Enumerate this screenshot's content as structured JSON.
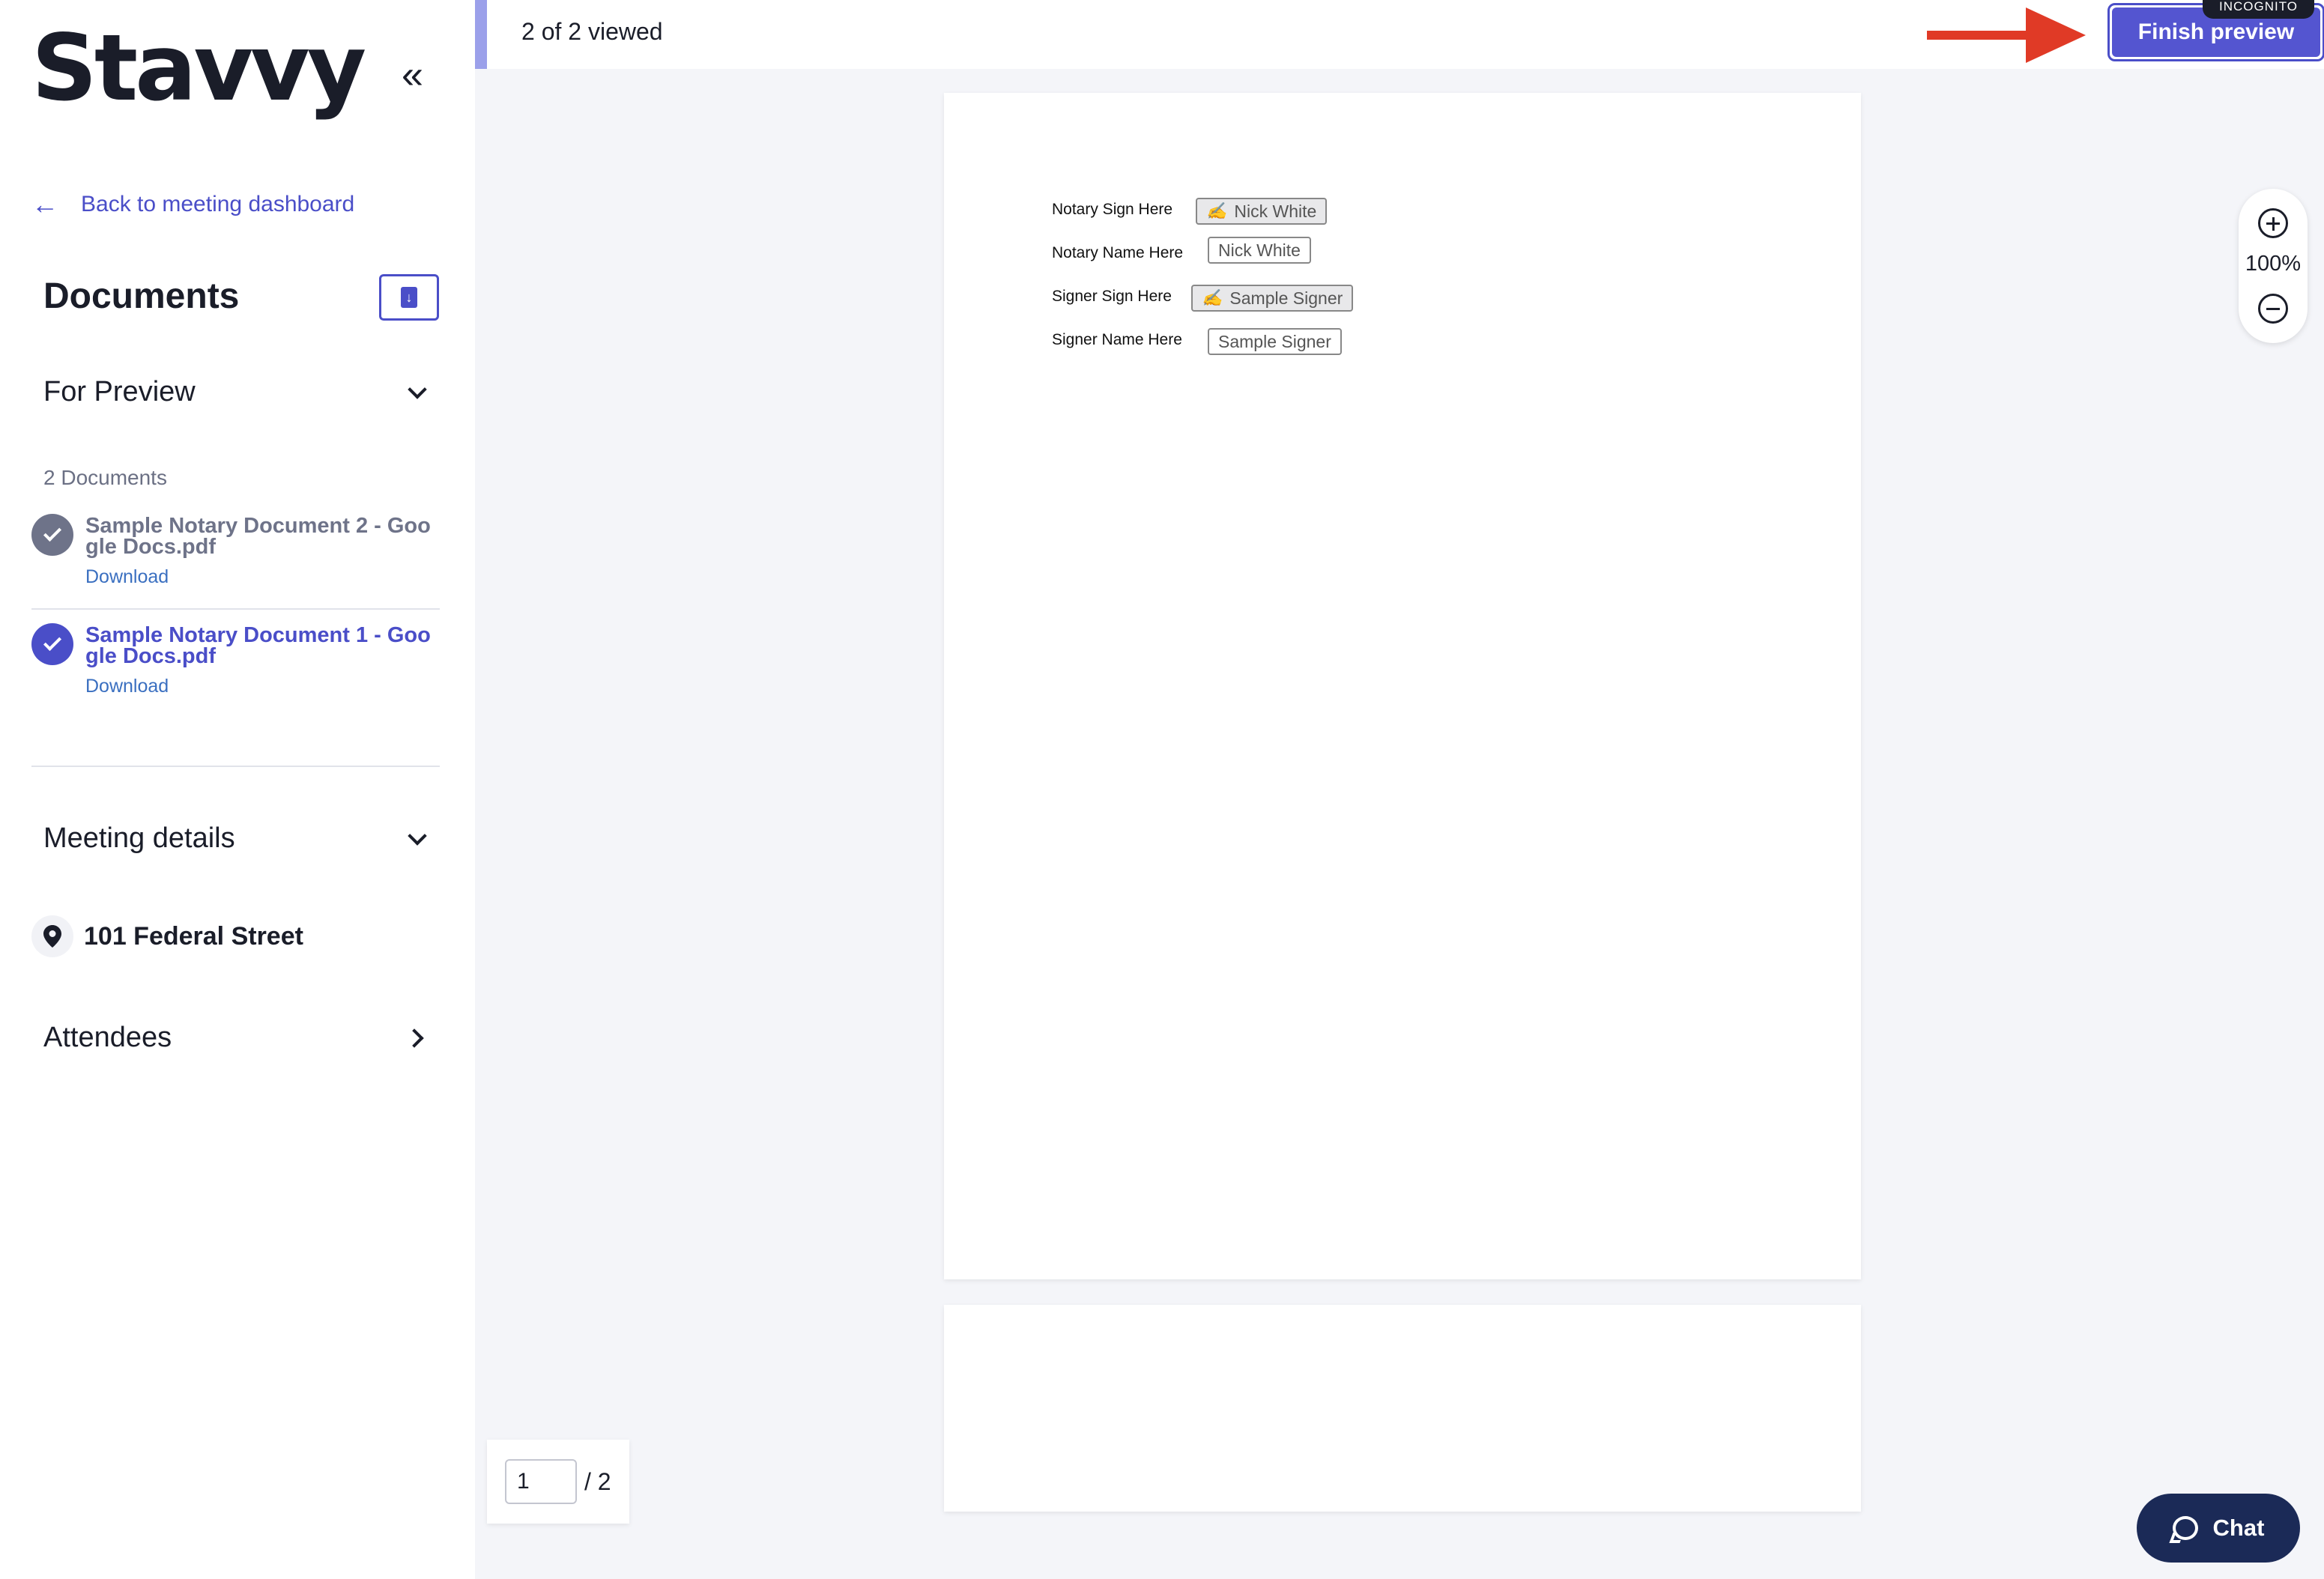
{
  "sidebar": {
    "logo": "Stavvy",
    "collapse_icon": "double-chevron-left-icon",
    "back_link": "Back to meeting dashboard",
    "documents_title": "Documents",
    "for_preview": {
      "label": "For Preview",
      "count_text": "2 Documents",
      "documents": [
        {
          "name": "Sample Notary Document 2 - Google Docs.pdf",
          "download": "Download",
          "viewed": true,
          "status_color": "#6e7389"
        },
        {
          "name": "Sample Notary Document 1 - Google Docs.pdf",
          "download": "Download",
          "viewed": true,
          "status_color": "#4a4ec8"
        }
      ]
    },
    "meeting_details": {
      "label": "Meeting details",
      "address": "101 Federal Street"
    },
    "attendees": {
      "label": "Attendees"
    }
  },
  "topbar": {
    "viewed_text": "2 of 2 viewed",
    "finish_button": "Finish preview",
    "incognito_badge": "INCOGNITO",
    "accent": "#5455d0"
  },
  "document": {
    "fields": [
      {
        "label": "Notary Sign Here",
        "value": "Nick White",
        "type": "signature"
      },
      {
        "label": "Notary Name Here",
        "value": "Nick White",
        "type": "text"
      },
      {
        "label": "Signer Sign Here",
        "value": "Sample Signer",
        "type": "signature"
      },
      {
        "label": "Signer Name Here",
        "value": "Sample Signer",
        "type": "text"
      }
    ]
  },
  "zoom": {
    "level": "100%"
  },
  "pagenav": {
    "current": "1",
    "total": "/ 2"
  },
  "chat": {
    "label": "Chat"
  }
}
